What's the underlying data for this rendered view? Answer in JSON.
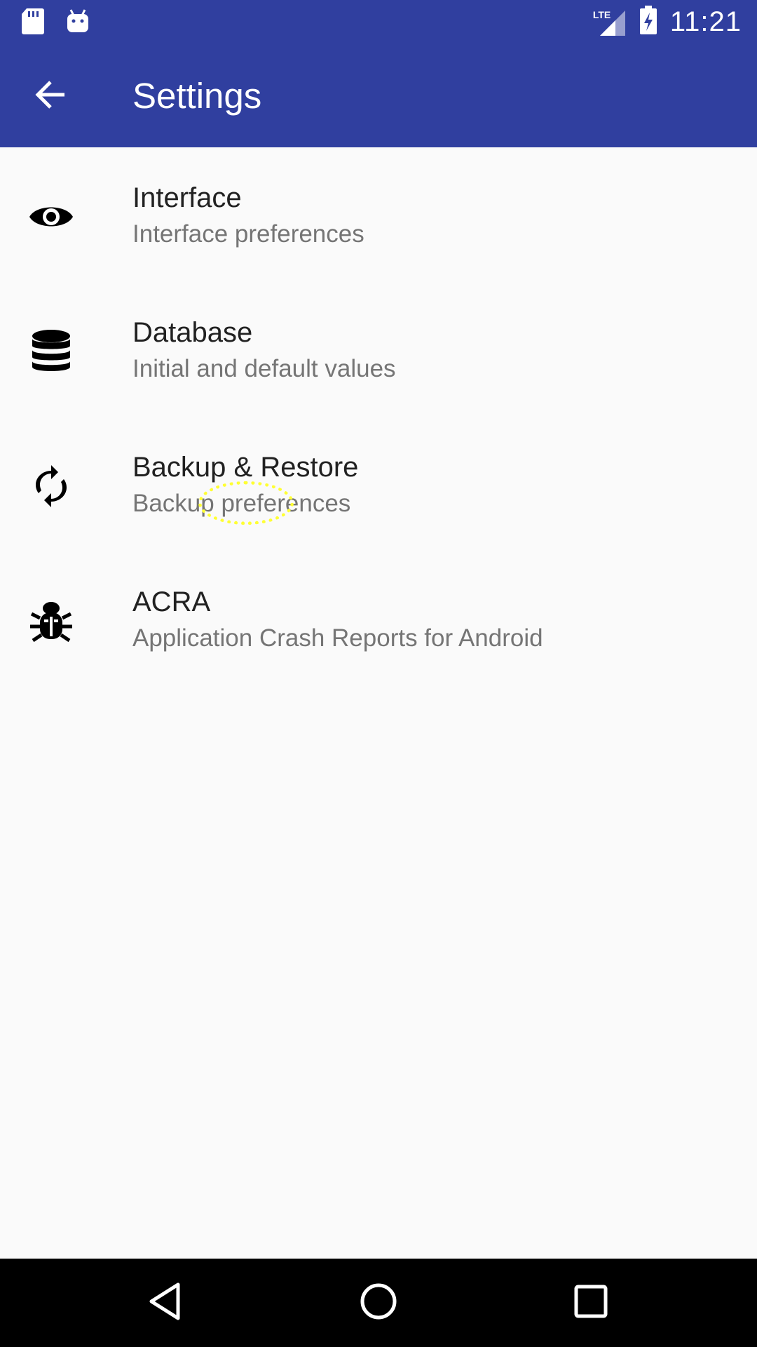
{
  "status_bar": {
    "time": "11:21",
    "network": "LTE",
    "icons": [
      "sd-card-icon",
      "android-icon",
      "signal-icon",
      "battery-charging-icon"
    ]
  },
  "app_bar": {
    "title": "Settings",
    "back_icon": "arrow-back-icon"
  },
  "settings_items": [
    {
      "title": "Interface",
      "subtitle": "Interface preferences",
      "icon": "eye-icon"
    },
    {
      "title": "Database",
      "subtitle": "Initial and default values",
      "icon": "database-icon"
    },
    {
      "title": "Backup & Restore",
      "subtitle": "Backup preferences",
      "icon": "sync-icon"
    },
    {
      "title": "ACRA",
      "subtitle": "Application Crash Reports for Android",
      "icon": "bug-icon"
    }
  ],
  "nav_bar": {
    "buttons": [
      "back-triangle-icon",
      "home-circle-icon",
      "recents-square-icon"
    ]
  },
  "colors": {
    "primary": "#303f9f",
    "background": "#fafafa",
    "title_text": "#212121",
    "subtitle_text": "#757575"
  }
}
